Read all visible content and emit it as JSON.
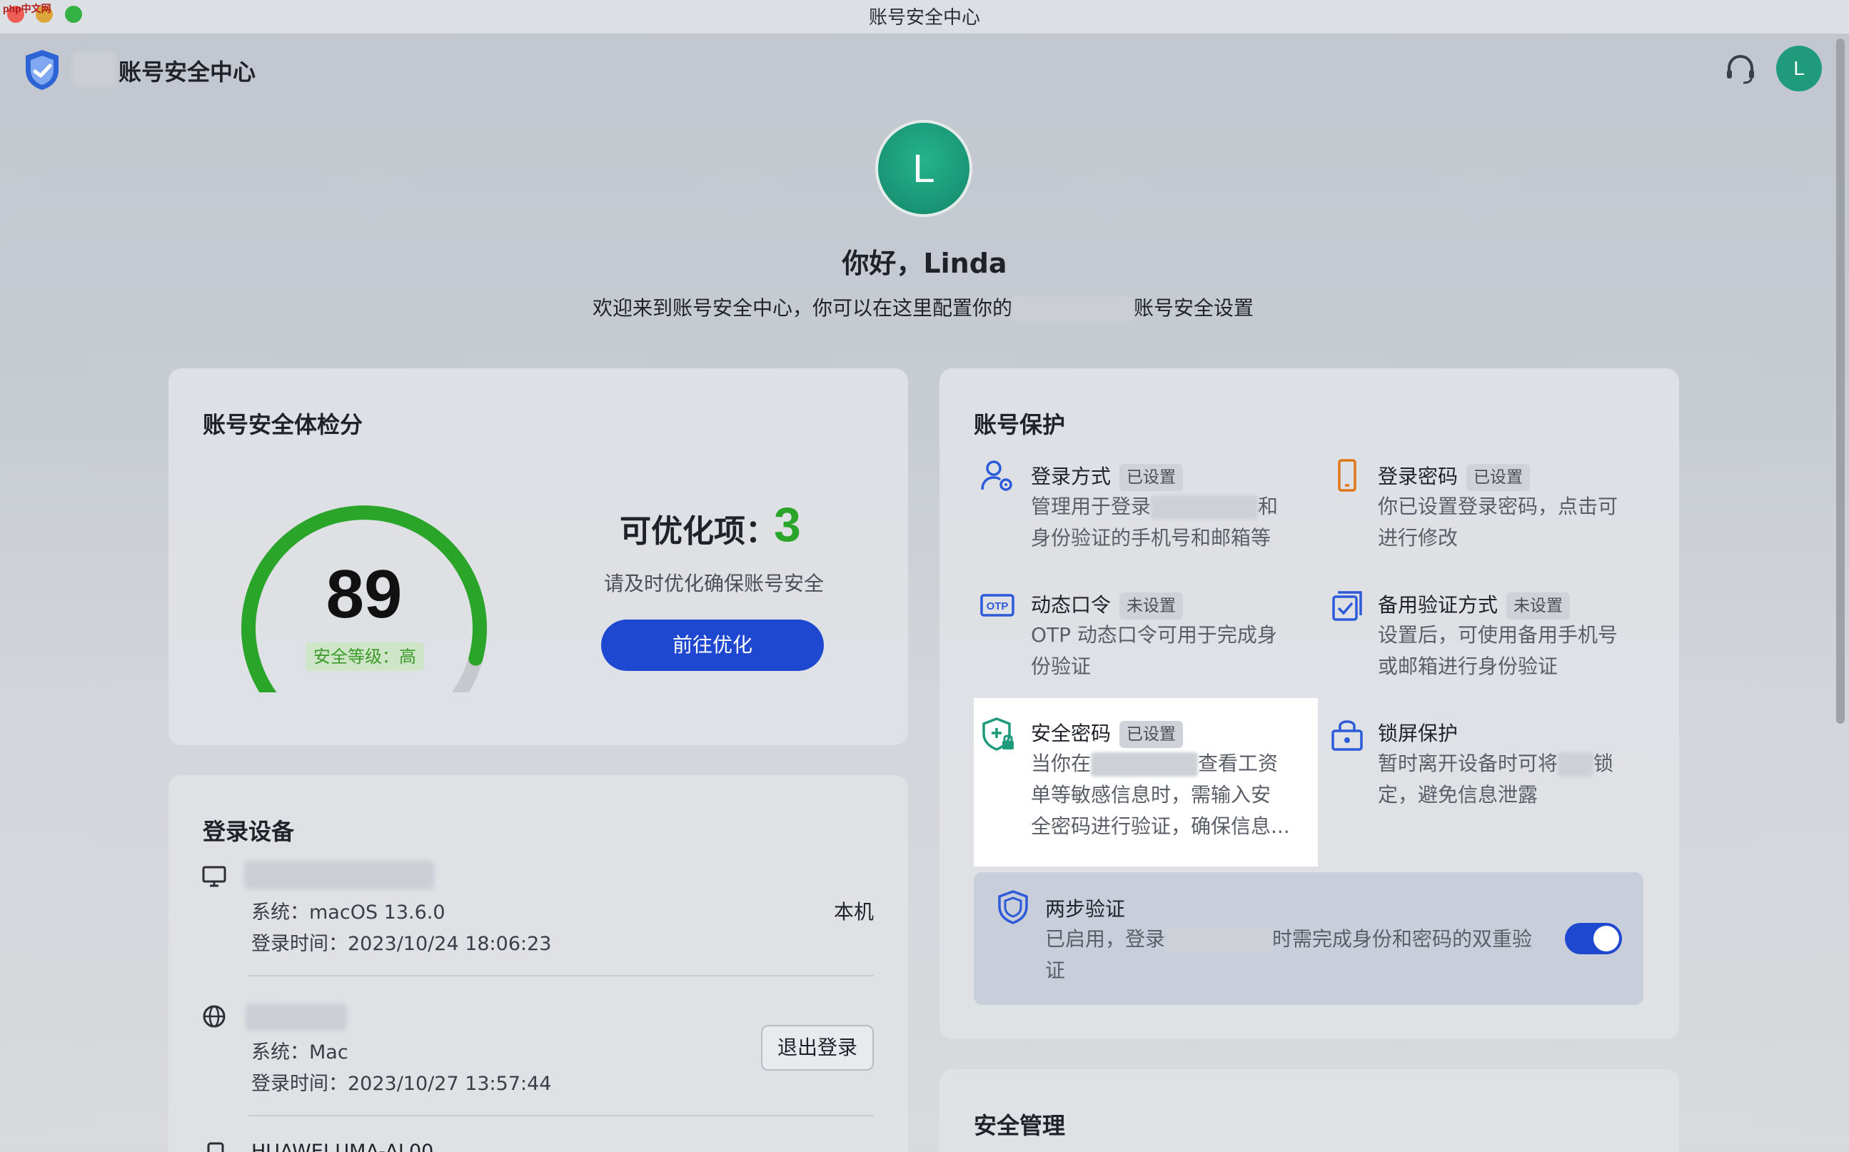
{
  "window": {
    "title": "账号安全中心",
    "watermark": "php中文网"
  },
  "header": {
    "app_name": "账号安全中心",
    "avatar_initial": "L"
  },
  "welcome": {
    "avatar_initial": "L",
    "greeting": "你好，Linda",
    "subtitle_before": "欢迎来到账号安全中心，你可以在这里配置你的",
    "subtitle_after": "账号安全设置"
  },
  "score_card": {
    "title": "账号安全体检分",
    "score": "89",
    "score_fraction": 0.89,
    "level": "安全等级：高",
    "optimize_label": "可优化项：",
    "optimize_count": "3",
    "optimize_desc": "请及时优化确保账号安全",
    "optimize_button": "前往优化",
    "colors": {
      "gauge": "#2aa52a",
      "track": "#c5c8cc",
      "button": "#1f48d0"
    }
  },
  "devices": {
    "title": "登录设备",
    "items": [
      {
        "icon": "monitor-icon",
        "system": "系统：macOS 13.6.0",
        "login_time": "登录时间：2023/10/24 18:06:23",
        "tag": "本机"
      },
      {
        "icon": "globe-icon",
        "system": "系统：Mac",
        "login_time": "登录时间：2023/10/27 13:57:44",
        "action": "退出登录"
      },
      {
        "icon": "phone-icon",
        "name": "HUAWEI UMA-AL00"
      }
    ]
  },
  "protection": {
    "title": "账号保护",
    "items": [
      {
        "icon": "login-method-icon",
        "title": "登录方式",
        "badge": "已设置",
        "desc1": "管理用于登录",
        "desc2": "和",
        "desc3": "身份验证的手机号和邮箱等"
      },
      {
        "icon": "phone-lock-icon",
        "title": "登录密码",
        "badge": "已设置",
        "desc1": "你已设置登录密码，点击可",
        "desc2": "进行修改"
      },
      {
        "icon": "otp-icon",
        "title": "动态口令",
        "badge": "未设置",
        "desc1": "OTP 动态口令可用于完成身",
        "desc2": "份验证"
      },
      {
        "icon": "backup-verify-icon",
        "title": "备用验证方式",
        "badge": "未设置",
        "desc1": "设置后，可使用备用手机号",
        "desc2": "或邮箱进行身份验证"
      },
      {
        "icon": "security-password-icon",
        "title": "安全密码",
        "badge": "已设置",
        "desc1": "当你在",
        "desc2": "查看工资",
        "desc3": "单等敏感信息时，需输入安",
        "desc4": "全密码进行验证，确保信息..."
      },
      {
        "icon": "lock-screen-icon",
        "title": "锁屏保护",
        "desc1": "暂时离开设备时可将",
        "desc2": "锁",
        "desc3": "定，避免信息泄露"
      }
    ],
    "two_step": {
      "title": "两步验证",
      "desc1": "已启用，登录",
      "desc2": "时需完成身份和密码的双重验",
      "desc3": "证",
      "enabled": true
    }
  },
  "security_mgmt": {
    "title": "安全管理"
  }
}
